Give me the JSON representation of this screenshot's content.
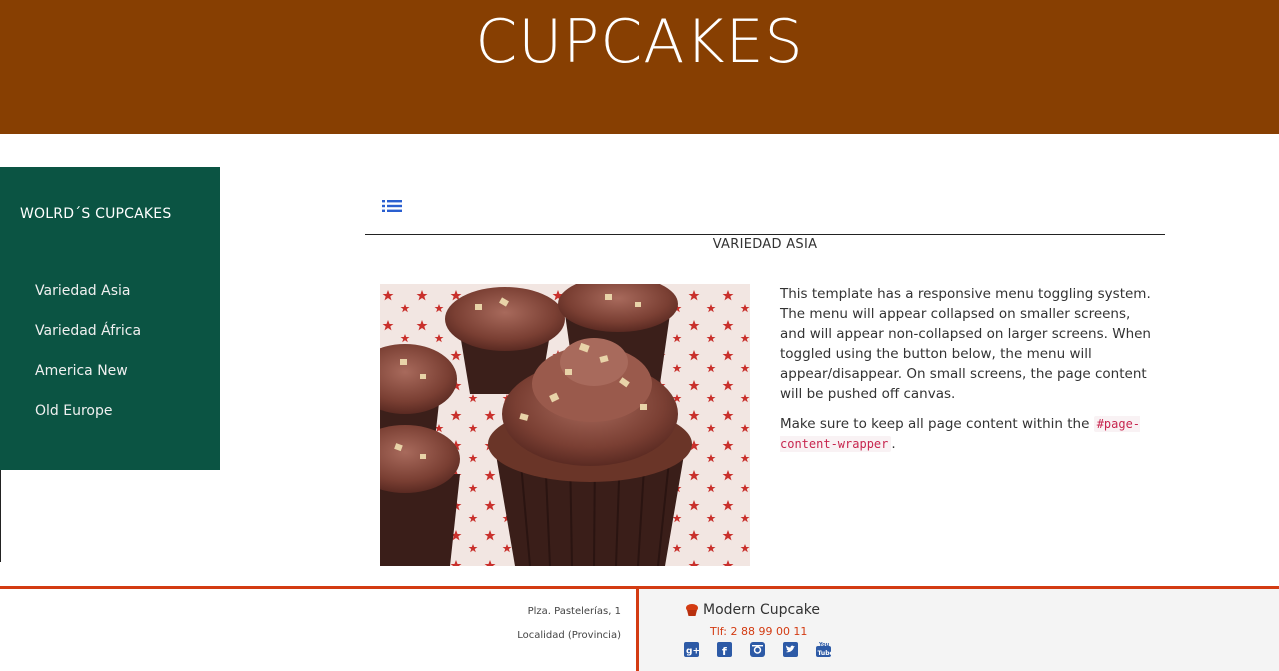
{
  "header": {
    "title": "CUPCAKES"
  },
  "sidebar": {
    "brand": "WOLRD´S CUPCAKES",
    "items": [
      {
        "label": "Variedad Asia"
      },
      {
        "label": "Variedad África"
      },
      {
        "label": "America New"
      },
      {
        "label": "Old Europe"
      }
    ]
  },
  "main": {
    "menu_toggle_icon": "list-icon",
    "section_title": "VARIEDAD ASIA",
    "photo_icon": "cupcake-photo",
    "paragraph_1": "This template has a responsive menu toggling system. The menu will appear collapsed on smaller screens, and will appear non-collapsed on larger screens. When toggled using the button below, the menu will appear/disappear. On small screens, the page content will be pushed off canvas.",
    "paragraph_2_prefix": "Make sure to keep all page content within the ",
    "paragraph_2_code": "#page-content-wrapper",
    "paragraph_2_suffix": "."
  },
  "footer": {
    "address_line_1": "Plza. Pastelerías, 1",
    "address_line_2": "Localidad (Provincia)",
    "brand": "Modern Cupcake",
    "phone": "Tlf: 2 88 99 00 11",
    "social_icons": [
      "google-plus-icon",
      "facebook-icon",
      "instagram-icon",
      "twitter-icon",
      "youtube-icon"
    ]
  },
  "colors": {
    "banner": "#873f02",
    "sidebar": "#0b5443",
    "accent": "#d33b12",
    "social": "#2d5aa6"
  }
}
